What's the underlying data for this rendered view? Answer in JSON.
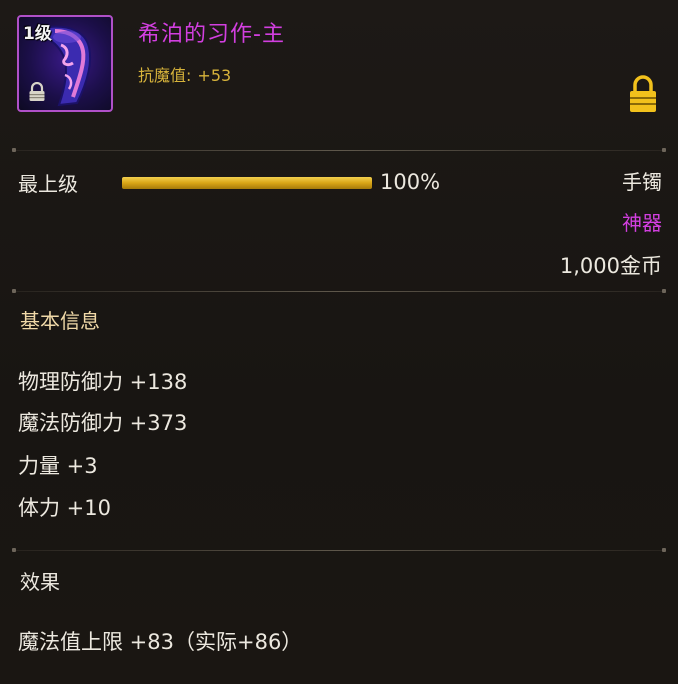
{
  "item": {
    "level": "1级",
    "name": "希泊的习作-主",
    "resist_label": "抗魔值:",
    "resist_value": "+53",
    "icon": "purple-bracelet-item-icon",
    "lock_icon": "padlock-icon"
  },
  "grade": {
    "label": "最上级",
    "percent": 100,
    "percent_text": "100%"
  },
  "meta": {
    "slot": "手镯",
    "rarity": "神器",
    "price": "1,000金币"
  },
  "basic_info": {
    "title": "基本信息",
    "stats": [
      "物理防御力 +138",
      "魔法防御力 +373",
      "力量 +3",
      "体力 +10"
    ]
  },
  "effects": {
    "title": "效果",
    "lines": [
      "魔法值上限 +83（实际+86）"
    ]
  },
  "colors": {
    "rarity": "#d23fe0",
    "gold": "#d9a516",
    "resist": "#d7b33b"
  }
}
